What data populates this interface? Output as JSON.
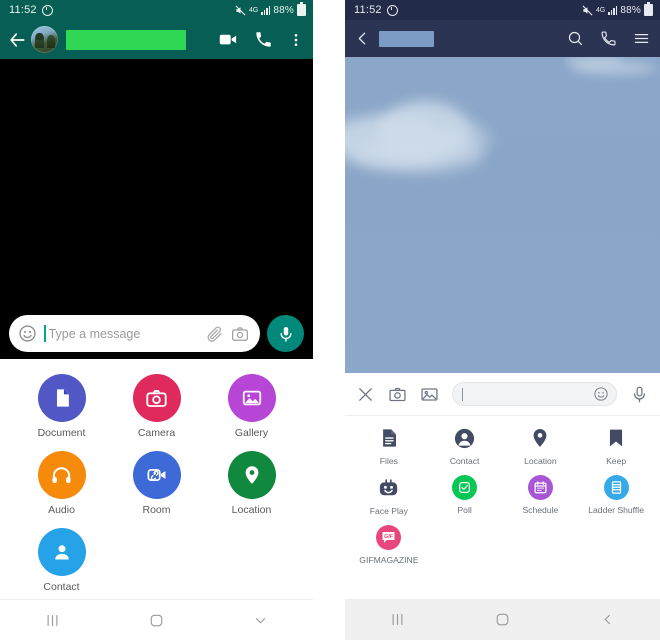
{
  "left_phone": {
    "app": "whatsapp",
    "status_bar": {
      "clock": "11:52",
      "alarm_icon": "alarm-icon",
      "mute_icon": "volume-mute-icon",
      "network": "4G",
      "signal_icon": "signal-bars-icon",
      "battery_percent": "88%",
      "battery_icon": "battery-icon"
    },
    "app_bar": {
      "back_icon": "back-arrow-icon",
      "avatar": "contact-avatar",
      "title_redacted": "",
      "video_call_icon": "video-call-icon",
      "voice_call_icon": "phone-call-icon",
      "overflow_icon": "more-options-icon",
      "bar_color": "#075e54"
    },
    "chat_area": {
      "background_color": "#000000"
    },
    "composer": {
      "emoji_icon": "emoji-icon",
      "placeholder": "Type a message",
      "attach_icon": "paperclip-icon",
      "camera_icon": "camera-icon",
      "mic_icon": "microphone-icon",
      "mic_button_color": "#00897b"
    },
    "attachment_sheet": {
      "items": [
        {
          "label": "Document",
          "icon": "document-icon",
          "color": "#5157c4"
        },
        {
          "label": "Camera",
          "icon": "camera-icon",
          "color": "#e0295c"
        },
        {
          "label": "Gallery",
          "icon": "gallery-icon",
          "color": "#b745d6"
        },
        {
          "label": "Audio",
          "icon": "headphones-icon",
          "color": "#f58a0b"
        },
        {
          "label": "Room",
          "icon": "room-video-icon",
          "color": "#3d6ad6"
        },
        {
          "label": "Location",
          "icon": "location-pin-icon",
          "color": "#10893e"
        },
        {
          "label": "Contact",
          "icon": "contact-person-icon",
          "color": "#26a3e8"
        }
      ]
    },
    "nav_bar": {
      "recents_icon": "recents-icon",
      "home_icon": "home-icon",
      "back_icon": "chevron-down-icon"
    }
  },
  "right_phone": {
    "app": "line",
    "status_bar": {
      "clock": "11:52",
      "alarm_icon": "alarm-icon",
      "mute_icon": "volume-mute-icon",
      "network": "4G",
      "signal_icon": "signal-bars-icon",
      "battery_percent": "88%",
      "battery_icon": "battery-icon"
    },
    "app_bar": {
      "back_icon": "chevron-left-icon",
      "title_redacted": "",
      "search_icon": "search-icon",
      "call_icon": "phone-call-icon",
      "menu_icon": "hamburger-menu-icon",
      "bar_color": "#2b3553"
    },
    "chat_area": {
      "background": "sky-with-clouds-wallpaper"
    },
    "composer": {
      "close_icon": "close-x-icon",
      "camera_icon": "camera-icon",
      "gallery_icon": "gallery-image-icon",
      "input_value": "",
      "sticker_icon": "smiley-sticker-icon",
      "mic_icon": "microphone-icon"
    },
    "attachment_sheet": {
      "items": [
        {
          "label": "Files",
          "icon": "files-icon",
          "color": "#424b63"
        },
        {
          "label": "Contact",
          "icon": "contact-person-icon",
          "color": "#424b63"
        },
        {
          "label": "Location",
          "icon": "location-pin-icon",
          "color": "#424b63"
        },
        {
          "label": "Keep",
          "icon": "bookmark-keep-icon",
          "color": "#424b63"
        },
        {
          "label": "Face Play",
          "icon": "face-play-icon",
          "color": "#424b63"
        },
        {
          "label": "Poll",
          "icon": "poll-check-icon",
          "color": "#06c755"
        },
        {
          "label": "Schedule",
          "icon": "calendar-icon",
          "color": "#a855d6"
        },
        {
          "label": "Ladder Shuffle",
          "icon": "ladder-icon",
          "color": "#36a9e8"
        },
        {
          "label": "GIFMAGAZINE",
          "icon": "gif-icon",
          "color": "#e8477e"
        }
      ]
    },
    "nav_bar": {
      "recents_icon": "recents-icon",
      "home_icon": "home-icon",
      "back_icon": "chevron-left-icon"
    }
  }
}
